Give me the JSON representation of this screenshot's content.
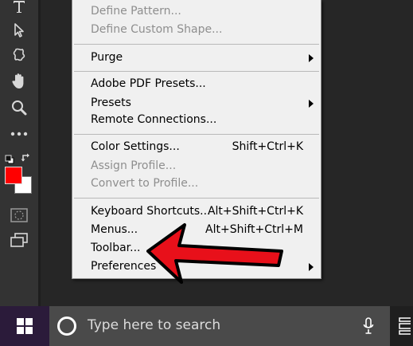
{
  "colors": {
    "foreground_swatch": "#ff0000",
    "background_swatch": "#ffffff",
    "annotation_arrow": "#e8101a"
  },
  "toolbar": {
    "icons": [
      "type-tool-icon",
      "path-selection-icon",
      "custom-shape-icon",
      "hand-tool-icon",
      "zoom-tool-icon",
      "more-tools-icon",
      "default-colors-icon",
      "swap-colors-icon",
      "quick-mask-icon",
      "screen-mode-icon"
    ]
  },
  "edit_menu": {
    "items": [
      {
        "label": "Define Pattern...",
        "disabled": true
      },
      {
        "label": "Define Custom Shape...",
        "disabled": true
      },
      {
        "label": "Purge",
        "submenu": true
      },
      {
        "label": "Adobe PDF Presets..."
      },
      {
        "label": "Presets",
        "submenu": true
      },
      {
        "label": "Remote Connections..."
      },
      {
        "label": "Color Settings...",
        "shortcut": "Shift+Ctrl+K"
      },
      {
        "label": "Assign Profile...",
        "disabled": true
      },
      {
        "label": "Convert to Profile...",
        "disabled": true
      },
      {
        "label": "Keyboard Shortcuts...",
        "shortcut": "Alt+Shift+Ctrl+K"
      },
      {
        "label": "Menus...",
        "shortcut": "Alt+Shift+Ctrl+M"
      },
      {
        "label": "Toolbar..."
      },
      {
        "label": "Preferences",
        "submenu": true
      }
    ]
  },
  "taskbar": {
    "search_placeholder": "Type here to search"
  }
}
